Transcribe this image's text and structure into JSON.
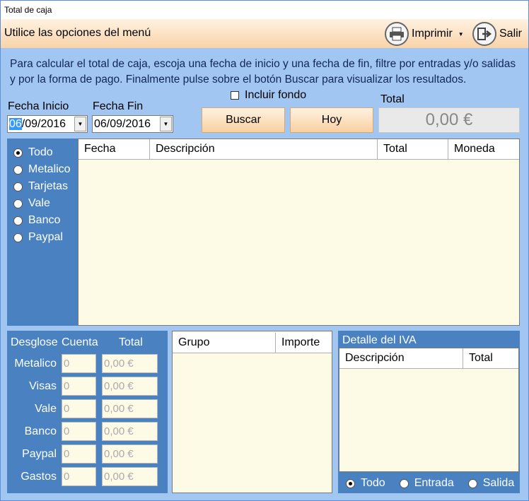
{
  "window": {
    "title": "Total de caja"
  },
  "menu": {
    "hint": "Utilice las opciones del menú",
    "print_label": "Imprimir",
    "exit_label": "Salir"
  },
  "instructions": "Para calcular el total de caja, escoja una fecha de inicio y una fecha de fin, filtre por entradas y/o salidas y por la forma de pago. Finalmente pulse sobre el botón Buscar para visualizar los resultados.",
  "filters": {
    "fecha_inicio_label": "Fecha Inicio",
    "fecha_inicio_sel": "06",
    "fecha_inicio_rest": "/09/2016",
    "fecha_fin_label": "Fecha Fin",
    "fecha_fin_value": "06/09/2016",
    "incluir_fondo_label": "Incluir fondo",
    "incluir_fondo_checked": false,
    "buscar_label": "Buscar",
    "hoy_label": "Hoy",
    "total_label": "Total",
    "total_value": "0,00 €"
  },
  "payment_types": [
    {
      "label": "Todo",
      "selected": true
    },
    {
      "label": "Metalico",
      "selected": false
    },
    {
      "label": "Tarjetas",
      "selected": false
    },
    {
      "label": "Vale",
      "selected": false
    },
    {
      "label": "Banco",
      "selected": false
    },
    {
      "label": "Paypal",
      "selected": false
    }
  ],
  "main_grid": {
    "columns": [
      "Fecha",
      "Descripción",
      "Total",
      "Moneda"
    ]
  },
  "desglose": {
    "headers": [
      "Desglose",
      "Cuenta",
      "Total"
    ],
    "rows": [
      {
        "label": "Metalico",
        "cuenta": "0",
        "total": "0,00 €"
      },
      {
        "label": "Visas",
        "cuenta": "0",
        "total": "0,00 €"
      },
      {
        "label": "Vale",
        "cuenta": "0",
        "total": "0,00 €"
      },
      {
        "label": "Banco",
        "cuenta": "0",
        "total": "0,00 €"
      },
      {
        "label": "Paypal",
        "cuenta": "0",
        "total": "0,00 €"
      },
      {
        "label": "Gastos",
        "cuenta": "0",
        "total": "0,00 €"
      }
    ]
  },
  "group_grid": {
    "columns": [
      "Grupo",
      "Importe"
    ]
  },
  "iva": {
    "title": "Detalle del IVA",
    "columns": [
      "Descripción",
      "Total"
    ],
    "options": [
      {
        "label": "Todo",
        "selected": true
      },
      {
        "label": "Entrada",
        "selected": false
      },
      {
        "label": "Salida",
        "selected": false
      }
    ]
  }
}
